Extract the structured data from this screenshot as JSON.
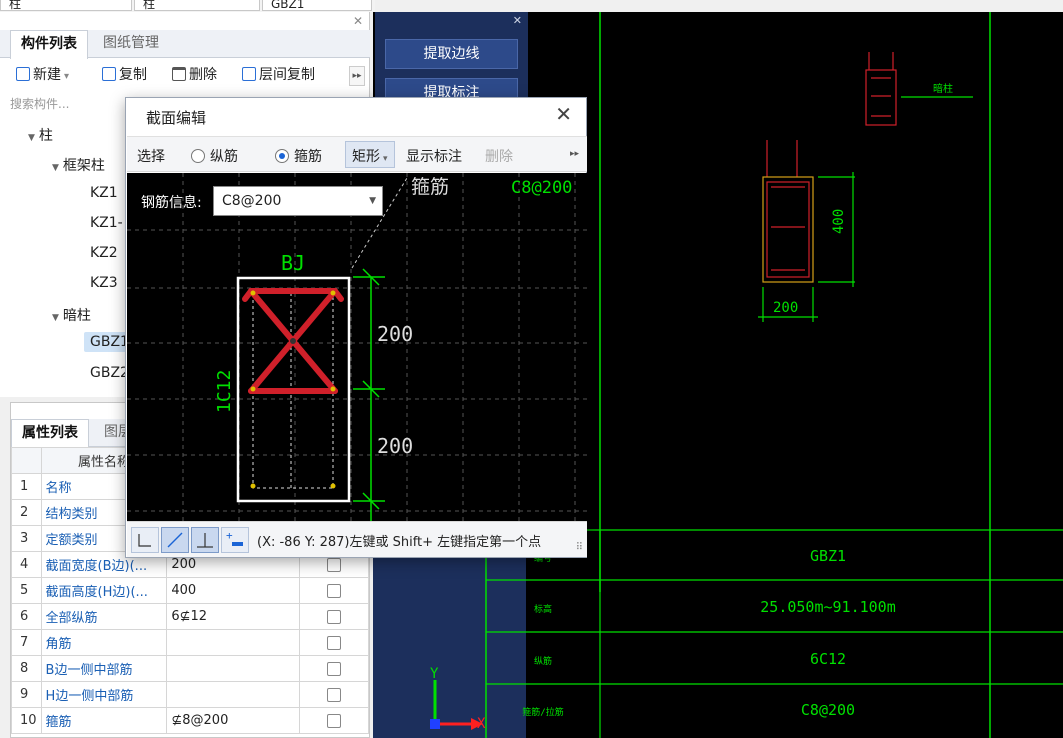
{
  "top_strip": {
    "fields": [
      "柱",
      "柱",
      "GBZ1"
    ]
  },
  "component_panel": {
    "tabs": [
      "构件列表",
      "图纸管理"
    ],
    "toolbar": {
      "new": "新建",
      "copy": "复制",
      "delete": "删除",
      "floor_copy": "层间复制"
    },
    "search_placeholder": "搜索构件...",
    "tree": {
      "root": "柱",
      "frame_column": "框架柱",
      "frame_items": [
        "KZ1",
        "KZ1-",
        "KZ2",
        "KZ3"
      ],
      "hidden_column": "暗柱",
      "hidden_items": [
        "GBZ1",
        "GBZ2"
      ]
    }
  },
  "property_panel": {
    "tabs": [
      "属性列表",
      "图层"
    ],
    "header": "属性名称",
    "rows": [
      {
        "num": "1",
        "name": "名称",
        "value": ""
      },
      {
        "num": "2",
        "name": "结构类别",
        "value": ""
      },
      {
        "num": "3",
        "name": "定额类别",
        "value": ""
      },
      {
        "num": "4",
        "name": "截面宽度(B边)(...",
        "value": "200"
      },
      {
        "num": "5",
        "name": "截面高度(H边)(...",
        "value": "400"
      },
      {
        "num": "6",
        "name": "全部纵筋",
        "value": "6⊈12"
      },
      {
        "num": "7",
        "name": "角筋",
        "value": ""
      },
      {
        "num": "8",
        "name": "B边一侧中部筋",
        "value": ""
      },
      {
        "num": "9",
        "name": "H边一侧中部筋",
        "value": ""
      },
      {
        "num": "10",
        "name": "箍筋",
        "value": "⊈8@200"
      }
    ]
  },
  "side_panel": {
    "buttons": [
      "提取边线",
      "提取标注"
    ]
  },
  "dialog": {
    "title": "截面编辑",
    "toolbar": {
      "select": "选择",
      "longitudinal": "纵筋",
      "stirrup": "箍筋",
      "shape": "矩形",
      "show_dim": "显示标注",
      "delete": "删除"
    },
    "rebar_info_label": "钢筋信息:",
    "rebar_info_value": "C8@200",
    "canvas": {
      "stirrup_label": "箍筋",
      "stirrup_spec": "C8@200",
      "bj": "BJ",
      "bar_spec": "1C12",
      "dim1": "200",
      "dim2": "200"
    },
    "status": "(X: -86 Y: 287)左键或 Shift+ 左键指定第一个点"
  },
  "cad": {
    "marker": "暗柱",
    "height_dim": "400",
    "width_dim": "200",
    "table": [
      {
        "label": "编号",
        "value": "GBZ1"
      },
      {
        "label": "标高",
        "value": "25.050m~91.100m"
      },
      {
        "label": "纵筋",
        "value": "6C12"
      },
      {
        "label": "箍筋/拉筋",
        "value": "C8@200"
      }
    ],
    "axis_x": "X",
    "axis_y": "Y"
  },
  "colors": {
    "cad_green": "#00e000",
    "rebar_red": "#d0202a",
    "dialog_accent": "#1a64d6"
  }
}
